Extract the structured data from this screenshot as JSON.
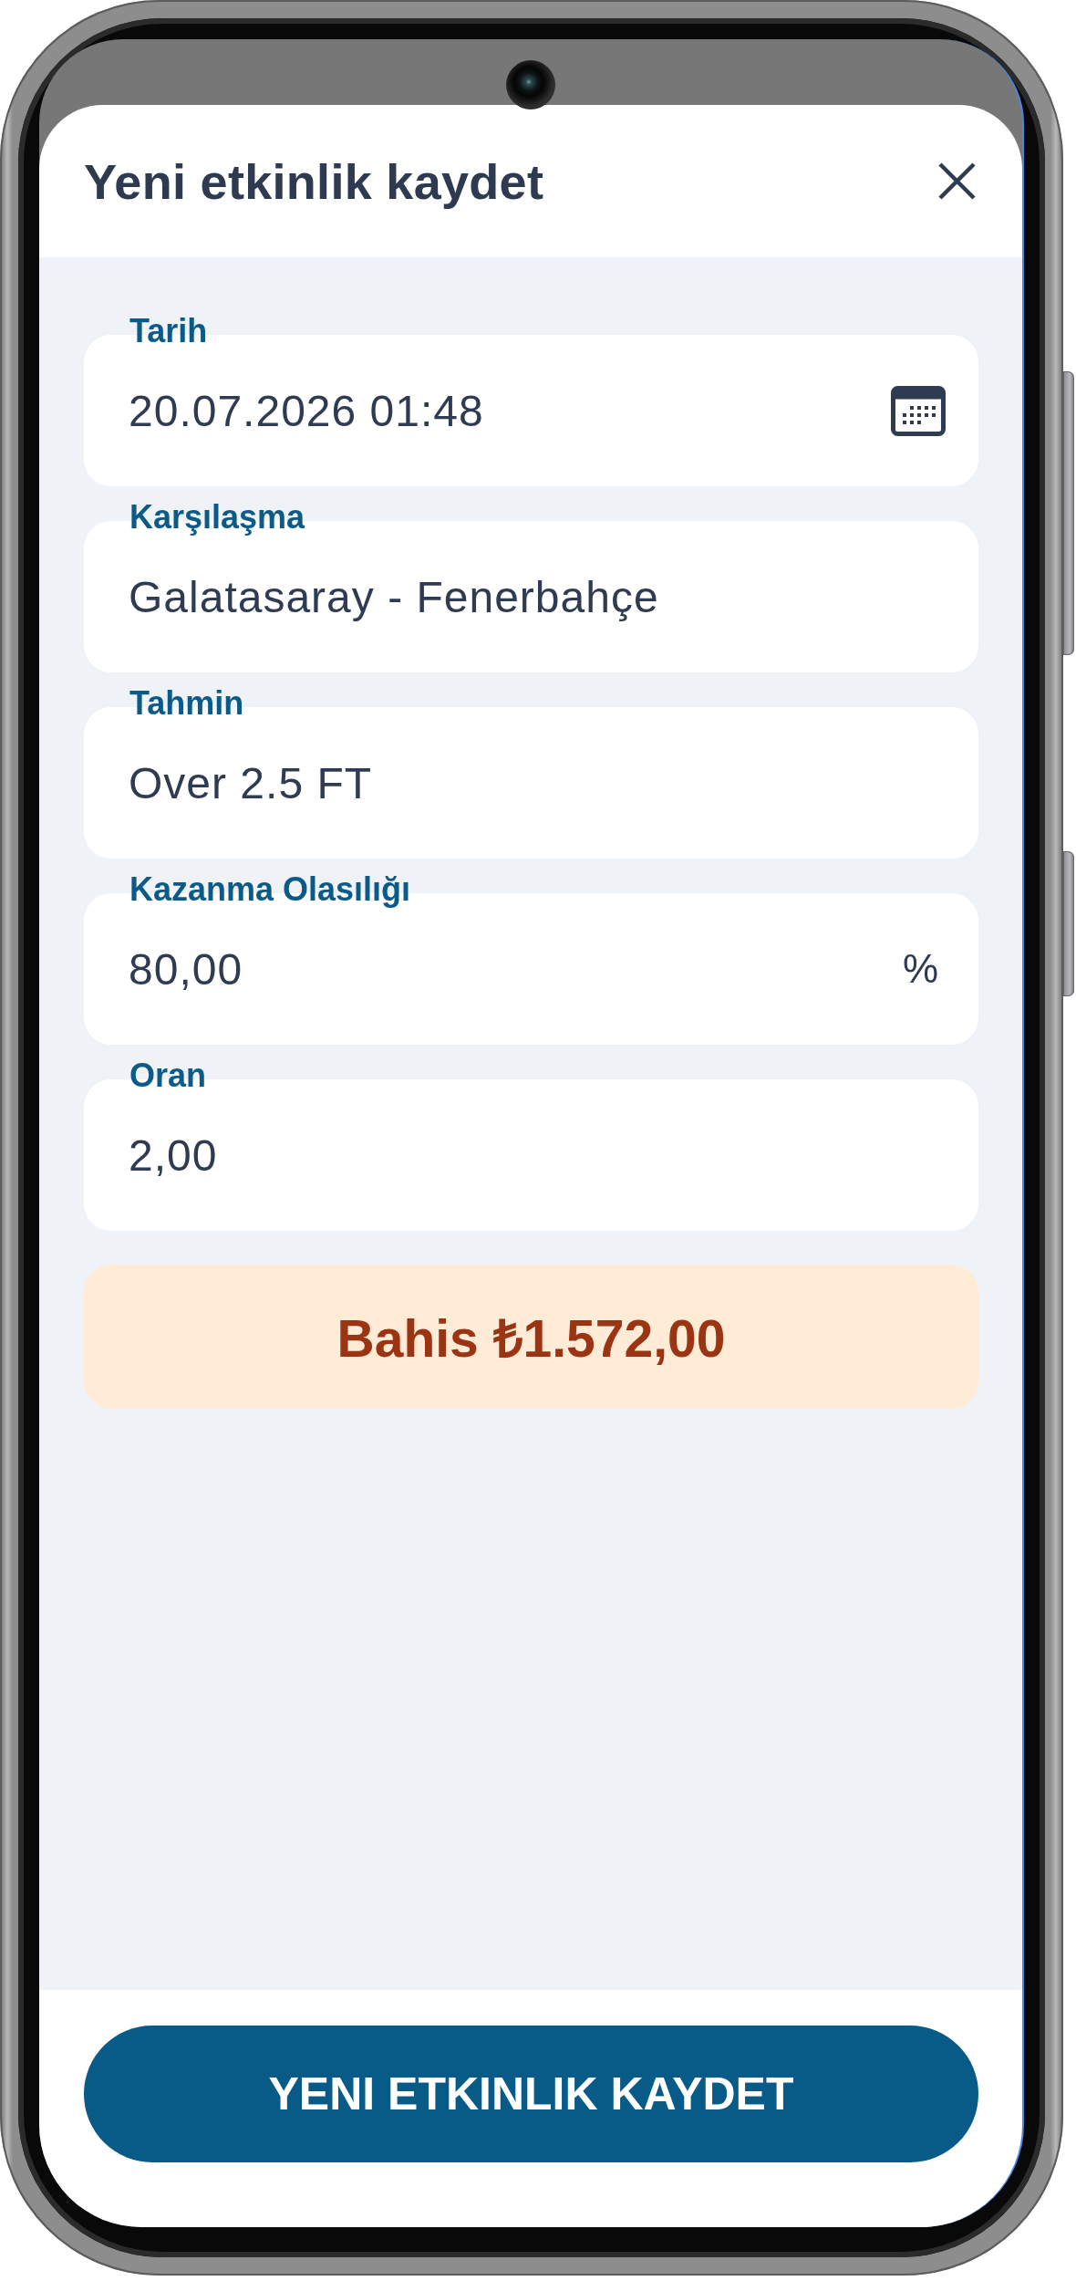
{
  "sheet": {
    "title": "Yeni etkinlik kaydet"
  },
  "fields": [
    {
      "kind": "date",
      "label": "Tarih",
      "value": "20.07.2026 01:48"
    },
    {
      "kind": "plain",
      "label": "Karşılaşma",
      "value": "Galatasaray - Fenerbahçe"
    },
    {
      "kind": "plain",
      "label": "Tahmin",
      "value": "Over 2.5 FT"
    },
    {
      "kind": "suffixed",
      "label": "Kazanma Olasılığı",
      "value": "80,00",
      "suffix": "%"
    },
    {
      "kind": "plain",
      "label": "Oran",
      "value": "2,00"
    }
  ],
  "stake_summary": {
    "text": "Bahis ₺1.572,00"
  },
  "save_button": {
    "label": "YENI ETKINLIK KAYDET"
  }
}
